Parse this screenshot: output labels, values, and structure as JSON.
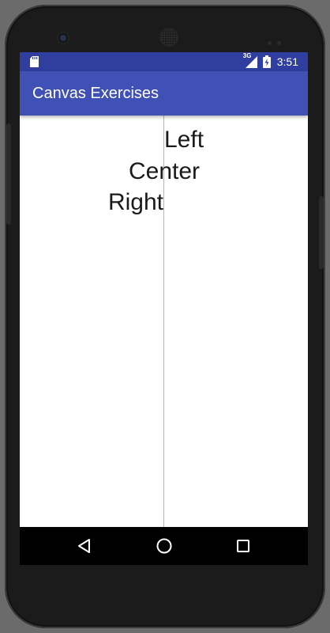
{
  "device": {
    "frame_color": "#1b1b1b",
    "status_bar_color": "#303f9f",
    "app_bar_color": "#3f51b5"
  },
  "status_bar": {
    "left_icons": [
      "sd-card-icon"
    ],
    "network_type": "3G",
    "right_icons": [
      "signal-icon",
      "battery-charging-icon"
    ],
    "time": "3:51"
  },
  "app_bar": {
    "title": "Canvas Exercises"
  },
  "canvas": {
    "texts": [
      {
        "label": "Left",
        "align": "left"
      },
      {
        "label": "Center",
        "align": "center"
      },
      {
        "label": "Right",
        "align": "right"
      }
    ],
    "guide_line": "vertical-center"
  },
  "nav_bar": {
    "icons": [
      "back-icon",
      "home-icon",
      "recents-icon"
    ]
  }
}
